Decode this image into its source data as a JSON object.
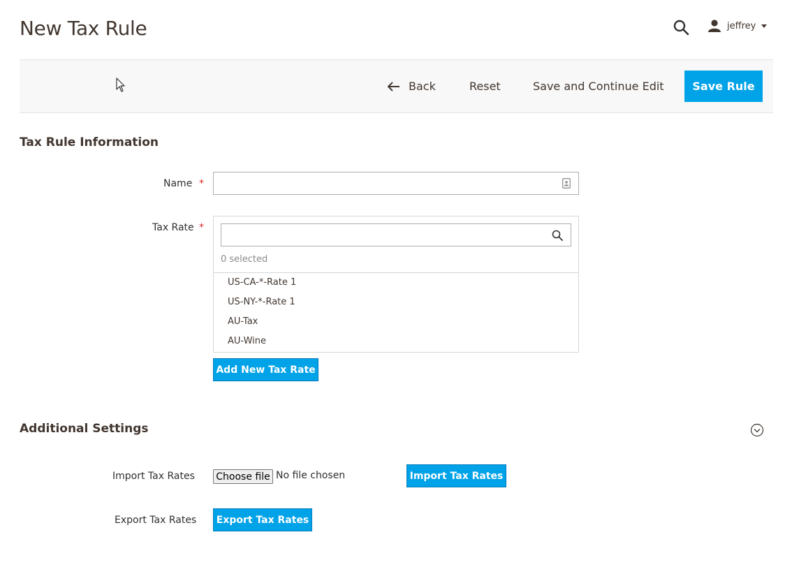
{
  "header": {
    "title": "New Tax Rule",
    "user_name": "jeffrey"
  },
  "toolbar": {
    "back_label": "Back",
    "reset_label": "Reset",
    "save_continue_label": "Save and Continue Edit",
    "save_rule_label": "Save Rule"
  },
  "tax_rule_info": {
    "section_title": "Tax Rule Information",
    "name_label": "Name",
    "name_value": "",
    "tax_rate_label": "Tax Rate",
    "tax_rate_search_value": "",
    "selected_count": "0 selected",
    "rates": [
      "US-CA-*-Rate 1",
      "US-NY-*-Rate 1",
      "AU-Tax",
      "AU-Wine"
    ],
    "add_rate_label": "Add New Tax Rate"
  },
  "additional_settings": {
    "section_title": "Additional Settings",
    "import_label": "Import Tax Rates",
    "choose_file_label": "Choose file",
    "file_status": "No file chosen",
    "import_button_label": "Import Tax Rates",
    "export_label": "Export Tax Rates",
    "export_button_label": "Export Tax Rates"
  },
  "colors": {
    "primary_button": "#00a2e8",
    "required_star": "#e22626",
    "text": "#41362f"
  },
  "icons": [
    "search-icon",
    "user-icon",
    "chevron-down-icon",
    "arrow-left-icon",
    "contact-card-icon",
    "magnifier-icon",
    "collapse-chevron-icon",
    "mouse-cursor-icon"
  ]
}
